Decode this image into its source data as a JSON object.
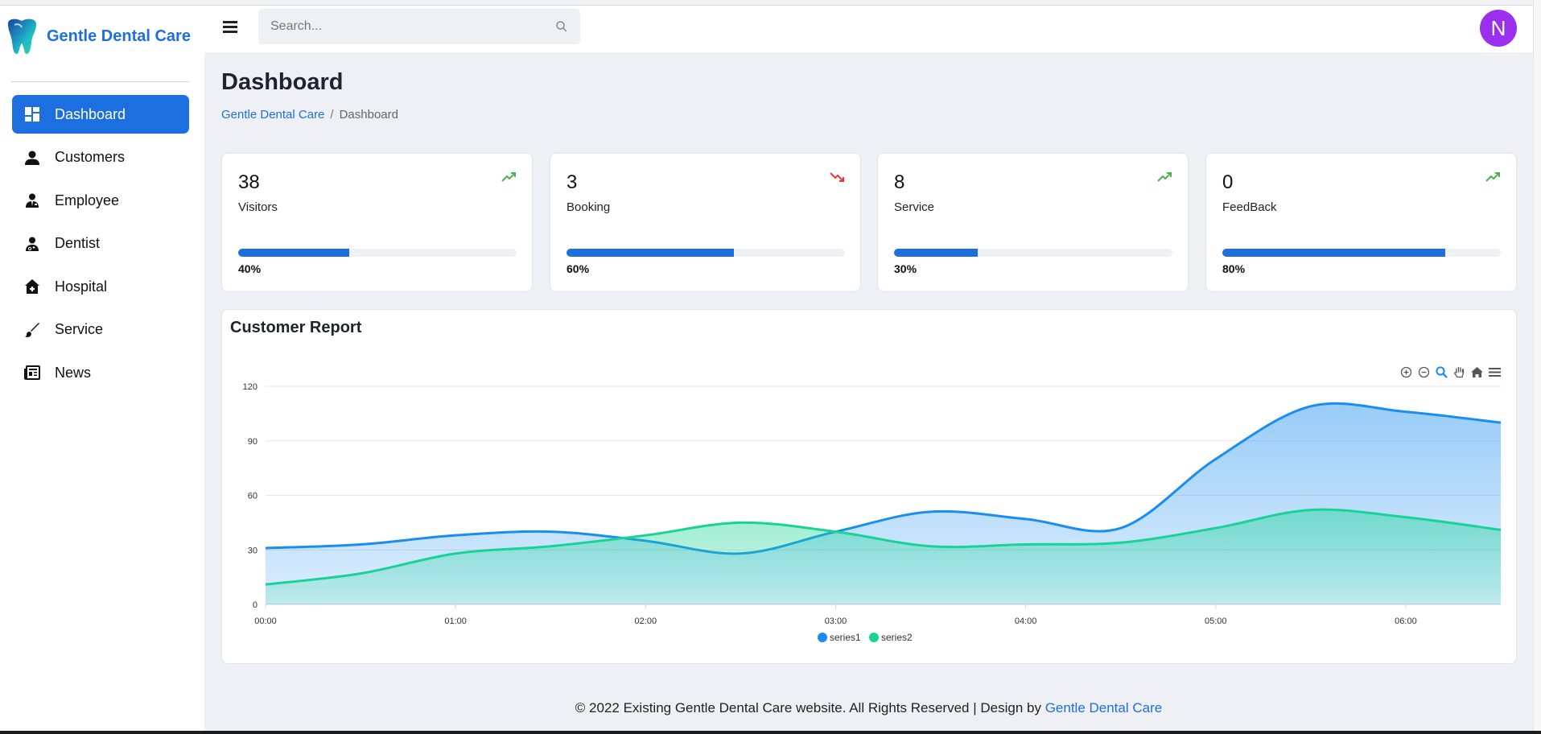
{
  "brand": {
    "name": "Gentle Dental Care"
  },
  "sidebar": {
    "items": [
      {
        "label": "Dashboard",
        "icon": "dashboard-icon",
        "active": true
      },
      {
        "label": "Customers",
        "icon": "person-icon"
      },
      {
        "label": "Employee",
        "icon": "employee-icon"
      },
      {
        "label": "Dentist",
        "icon": "doctor-icon"
      },
      {
        "label": "Hospital",
        "icon": "hospital-icon"
      },
      {
        "label": "Service",
        "icon": "brush-icon"
      },
      {
        "label": "News",
        "icon": "newspaper-icon"
      }
    ]
  },
  "header": {
    "search_placeholder": "Search...",
    "avatar_initial": "N"
  },
  "page": {
    "title": "Dashboard",
    "breadcrumb": {
      "root": "Gentle Dental Care",
      "sep": "/",
      "current": "Dashboard"
    }
  },
  "stats": [
    {
      "value": "38",
      "label": "Visitors",
      "trend": "up",
      "percent_label": "40%",
      "progress": 0.4
    },
    {
      "value": "3",
      "label": "Booking",
      "trend": "down",
      "percent_label": "60%",
      "progress": 0.6
    },
    {
      "value": "8",
      "label": "Service",
      "trend": "up",
      "percent_label": "30%",
      "progress": 0.3
    },
    {
      "value": "0",
      "label": "FeedBack",
      "trend": "up",
      "percent_label": "80%",
      "progress": 0.8
    }
  ],
  "colors": {
    "accent": "#1d6fe0",
    "trend_up": "#4caf50",
    "trend_down": "#e53935",
    "series1": "#1a8ef0",
    "series2": "#19d396",
    "avatar": "#9b2ff0"
  },
  "chart_title": "Customer Report",
  "chart_data": {
    "type": "area",
    "title": "Customer Report",
    "x": [
      "00:00",
      "00:30",
      "01:00",
      "01:30",
      "02:00",
      "02:30",
      "03:00",
      "03:30",
      "04:00",
      "04:30",
      "05:00",
      "05:30",
      "06:00",
      "06:30"
    ],
    "x_ticks": [
      "00:00",
      "01:00",
      "02:00",
      "03:00",
      "04:00",
      "05:00",
      "06:00"
    ],
    "y_ticks": [
      "0",
      "30",
      "60",
      "90",
      "120"
    ],
    "ylim": [
      0,
      120
    ],
    "series": [
      {
        "name": "series1",
        "values": [
          31,
          33,
          38,
          40,
          35,
          28,
          40,
          51,
          47,
          42,
          80,
          109,
          106,
          100
        ]
      },
      {
        "name": "series2",
        "values": [
          11,
          17,
          28,
          32,
          38,
          45,
          40,
          32,
          33,
          34,
          42,
          52,
          48,
          41
        ]
      }
    ],
    "grid": true,
    "legend": "bottom-center",
    "toolbar_icons": [
      "zoom-in-icon",
      "zoom-out-icon",
      "magnifier-icon",
      "pan-hand-icon",
      "home-icon",
      "menu-icon"
    ]
  },
  "footer": {
    "text": "© 2022 Existing Gentle Dental Care website. All Rights Reserved | Design by ",
    "link": "Gentle Dental Care"
  }
}
